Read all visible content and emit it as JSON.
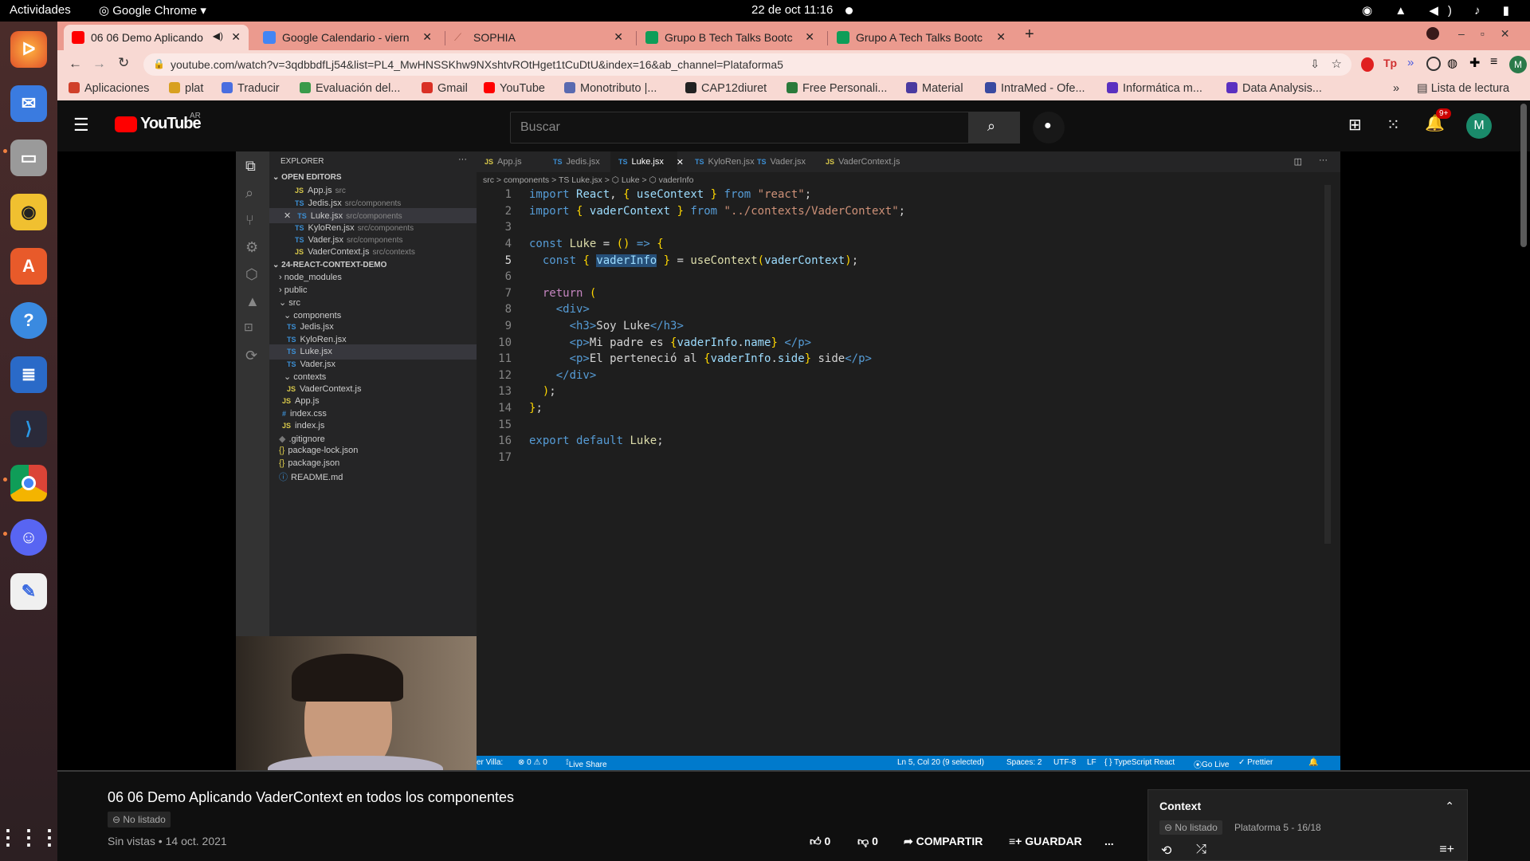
{
  "gnome": {
    "activities": "Actividades",
    "app_name": "Google Chrome",
    "clock": "22 de oct  11:16"
  },
  "dock": {
    "apps": [
      "firefox-icon",
      "thunderbird-icon",
      "files-icon",
      "rhythmbox-icon",
      "software-icon",
      "help-icon",
      "writer-icon",
      "vscode-icon",
      "chrome-icon",
      "discord-icon",
      "text-editor-icon",
      "app-grid-icon"
    ]
  },
  "chrome": {
    "tabs": [
      {
        "title": "06 06 Demo Aplicando",
        "favicon_color": "#ff0000"
      },
      {
        "title": "Google Calendario - viern",
        "favicon_color": "#4285f4"
      },
      {
        "title": "SOPHIA",
        "favicon_color": "#b06050"
      },
      {
        "title": "Grupo B Tech Talks Bootc",
        "favicon_color": "#0f9d58"
      },
      {
        "title": "Grupo A Tech Talks Bootc",
        "favicon_color": "#0f9d58"
      }
    ],
    "new_tab": "+",
    "url": "youtube.com/watch?v=3qdbbdfLj54&list=PL4_MwHNSSKhw9NXshtvROtHget1tCuDtU&index=16&ab_channel=Plataforma5",
    "avatar_letter": "M",
    "bookmarks": [
      {
        "label": "Aplicaciones",
        "color": "#d0402a"
      },
      {
        "label": "plat",
        "color": "#d8a020"
      },
      {
        "label": "Traducir",
        "color": "#4a6ee0"
      },
      {
        "label": "Evaluación del...",
        "color": "#3a9a4a"
      },
      {
        "label": "Gmail",
        "color": "#d93025"
      },
      {
        "label": "YouTube",
        "color": "#ff0000"
      },
      {
        "label": "Monotributo |...",
        "color": "#5a6ab0"
      },
      {
        "label": "CAP12diuret",
        "color": "#222222"
      },
      {
        "label": "Free Personali...",
        "color": "#2a7a3a"
      },
      {
        "label": "Material",
        "color": "#4a3aa0"
      },
      {
        "label": "IntraMed - Ofe...",
        "color": "#3a4aa0"
      },
      {
        "label": "Informática m...",
        "color": "#5a30c0"
      },
      {
        "label": "Data Analysis...",
        "color": "#5a30c0"
      }
    ],
    "reading_list": "Lista de lectura"
  },
  "youtube": {
    "logo_text": "YouTube",
    "region": "AR",
    "search_placeholder": "Buscar",
    "notification_count": "9+",
    "avatar_letter": "M"
  },
  "vscode": {
    "explorer_title": "EXPLORER",
    "open_editors_title": "OPEN EDITORS",
    "open_editors": [
      {
        "name": "App.js",
        "dir": "src",
        "lang": "JS"
      },
      {
        "name": "Jedis.jsx",
        "dir": "src/components",
        "lang": "TS"
      },
      {
        "name": "Luke.jsx",
        "dir": "src/components",
        "lang": "TS"
      },
      {
        "name": "KyloRen.jsx",
        "dir": "src/components",
        "lang": "TS"
      },
      {
        "name": "Vader.jsx",
        "dir": "src/components",
        "lang": "TS"
      },
      {
        "name": "VaderContext.js",
        "dir": "src/contexts",
        "lang": "JS"
      }
    ],
    "project_title": "24-REACT-CONTEXT-DEMO",
    "tree": [
      {
        "name": "node_modules",
        "kind": "folder",
        "icon": "›"
      },
      {
        "name": "public",
        "kind": "folder",
        "icon": "›"
      },
      {
        "name": "src",
        "kind": "folder",
        "icon": "⌄"
      },
      {
        "name": "components",
        "kind": "folder",
        "icon": "⌄"
      },
      {
        "name": "Jedis.jsx",
        "kind": "file",
        "icon": "TS"
      },
      {
        "name": "KyloRen.jsx",
        "kind": "file",
        "icon": "TS"
      },
      {
        "name": "Luke.jsx",
        "kind": "file",
        "icon": "TS"
      },
      {
        "name": "Vader.jsx",
        "kind": "file",
        "icon": "TS"
      },
      {
        "name": "contexts",
        "kind": "folder",
        "icon": "⌄"
      },
      {
        "name": "VaderContext.js",
        "kind": "file",
        "icon": "JS"
      },
      {
        "name": "App.js",
        "kind": "file",
        "icon": "JS"
      },
      {
        "name": "index.css",
        "kind": "file",
        "icon": "#"
      },
      {
        "name": "index.js",
        "kind": "file",
        "icon": "JS"
      },
      {
        "name": ".gitignore",
        "kind": "file",
        "icon": "◆"
      },
      {
        "name": "package-lock.json",
        "kind": "file",
        "icon": "{}"
      },
      {
        "name": "package.json",
        "kind": "file",
        "icon": "{}"
      },
      {
        "name": "README.md",
        "kind": "file",
        "icon": "ⓘ"
      }
    ],
    "editor_tabs": [
      "App.js",
      "Jedis.jsx",
      "Luke.jsx",
      "KyloRen.jsx",
      "Vader.jsx",
      "VaderContext.js"
    ],
    "breadcrumb": "src > components > TS Luke.jsx > ⬡ Luke > ⬡ vaderInfo",
    "line_numbers": [
      "1",
      "2",
      "3",
      "4",
      "5",
      "6",
      "7",
      "8",
      "9",
      "10",
      "11",
      "12",
      "13",
      "14",
      "15",
      "16",
      "17"
    ],
    "status": {
      "left": "er Villa:",
      "problems": "⊗ 0 ⚠ 0",
      "live_share": "Live Share",
      "position": "Ln 5, Col 20 (9 selected)",
      "spaces": "Spaces: 2",
      "encoding": "UTF-8",
      "eol": "LF",
      "language": "{ } TypeScript React",
      "go_live": "Go Live",
      "prettier": "✓ Prettier"
    }
  },
  "video": {
    "title": "06 06 Demo Aplicando VaderContext en todos los componentes",
    "visibility": "No listado",
    "views": "Sin vistas",
    "date": "14 oct. 2021",
    "likes": "0",
    "dislikes": "0",
    "share_label": "COMPARTIR",
    "save_label": "GUARDAR",
    "more": "..."
  },
  "playlist": {
    "title": "Context",
    "visibility": "No listado",
    "channel_progress": "Plataforma 5 - 16/18"
  }
}
